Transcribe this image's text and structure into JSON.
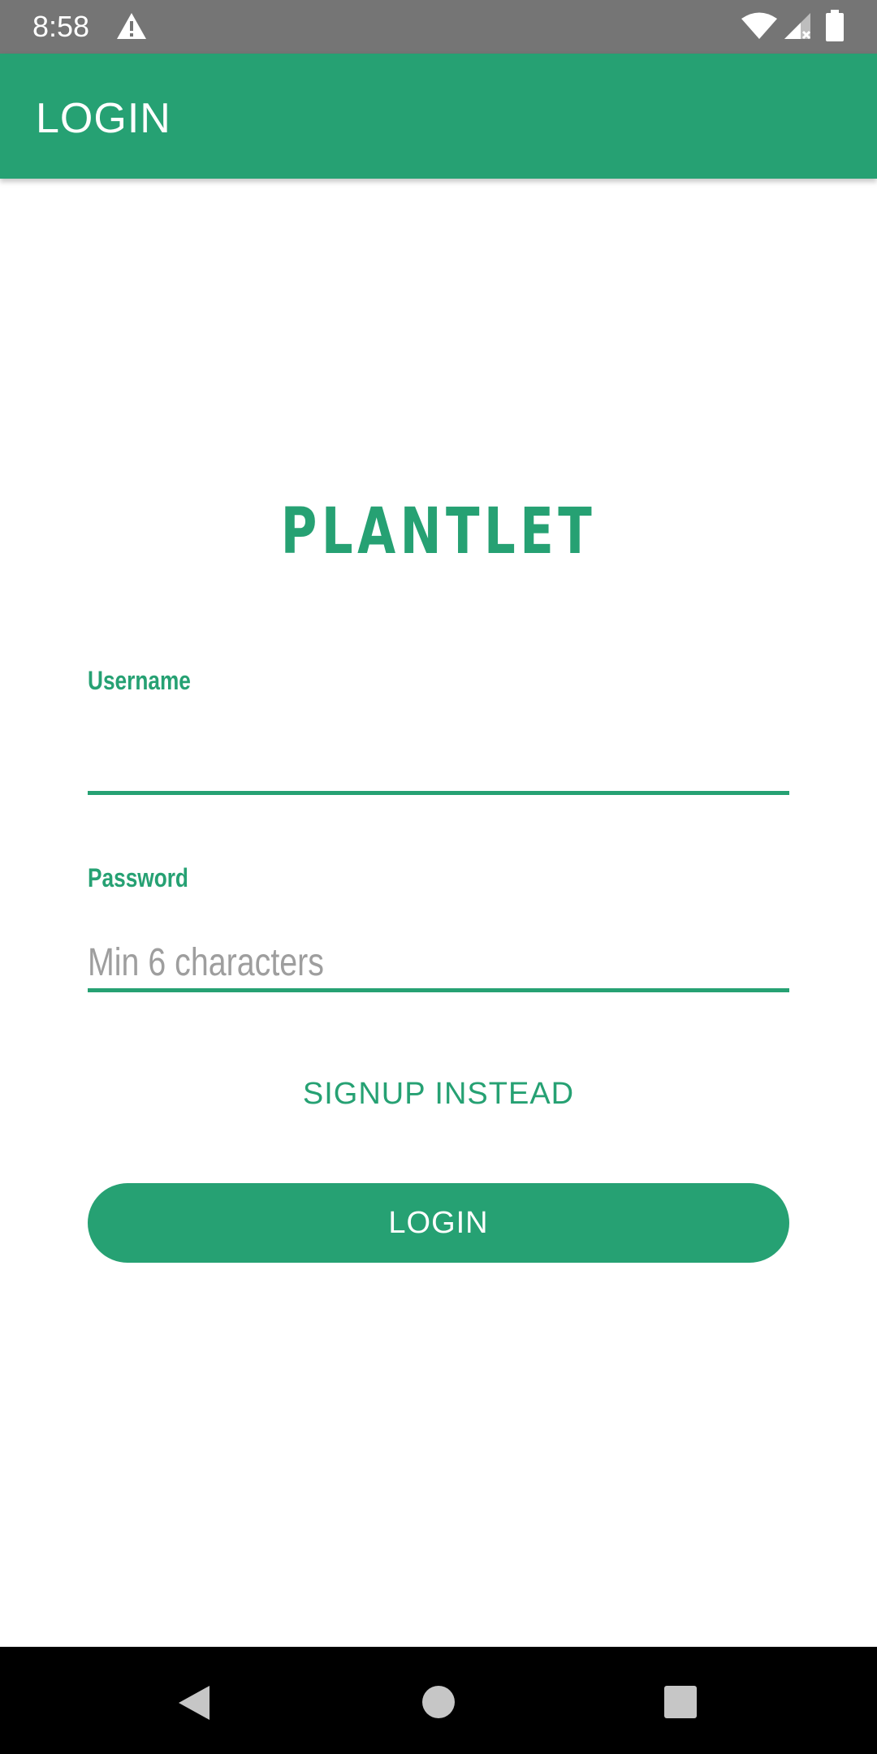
{
  "status_bar": {
    "time": "8:58",
    "icons": [
      "warning-icon",
      "wifi-icon",
      "signal-icon",
      "battery-icon"
    ]
  },
  "app_bar": {
    "title": "LOGIN",
    "color": "#26a173"
  },
  "brand": {
    "name": "PLANTLET"
  },
  "form": {
    "username": {
      "label": "Username",
      "value": "",
      "placeholder": ""
    },
    "password": {
      "label": "Password",
      "value": "",
      "placeholder": "Min 6 characters"
    },
    "signup_link": "SIGNUP INSTEAD",
    "login_button": "LOGIN"
  },
  "nav_bar": {
    "icons": [
      "back-icon",
      "home-icon",
      "recents-icon"
    ]
  },
  "colors": {
    "accent": "#26a173",
    "status_bar": "#757575",
    "placeholder": "#9e9e9e"
  }
}
